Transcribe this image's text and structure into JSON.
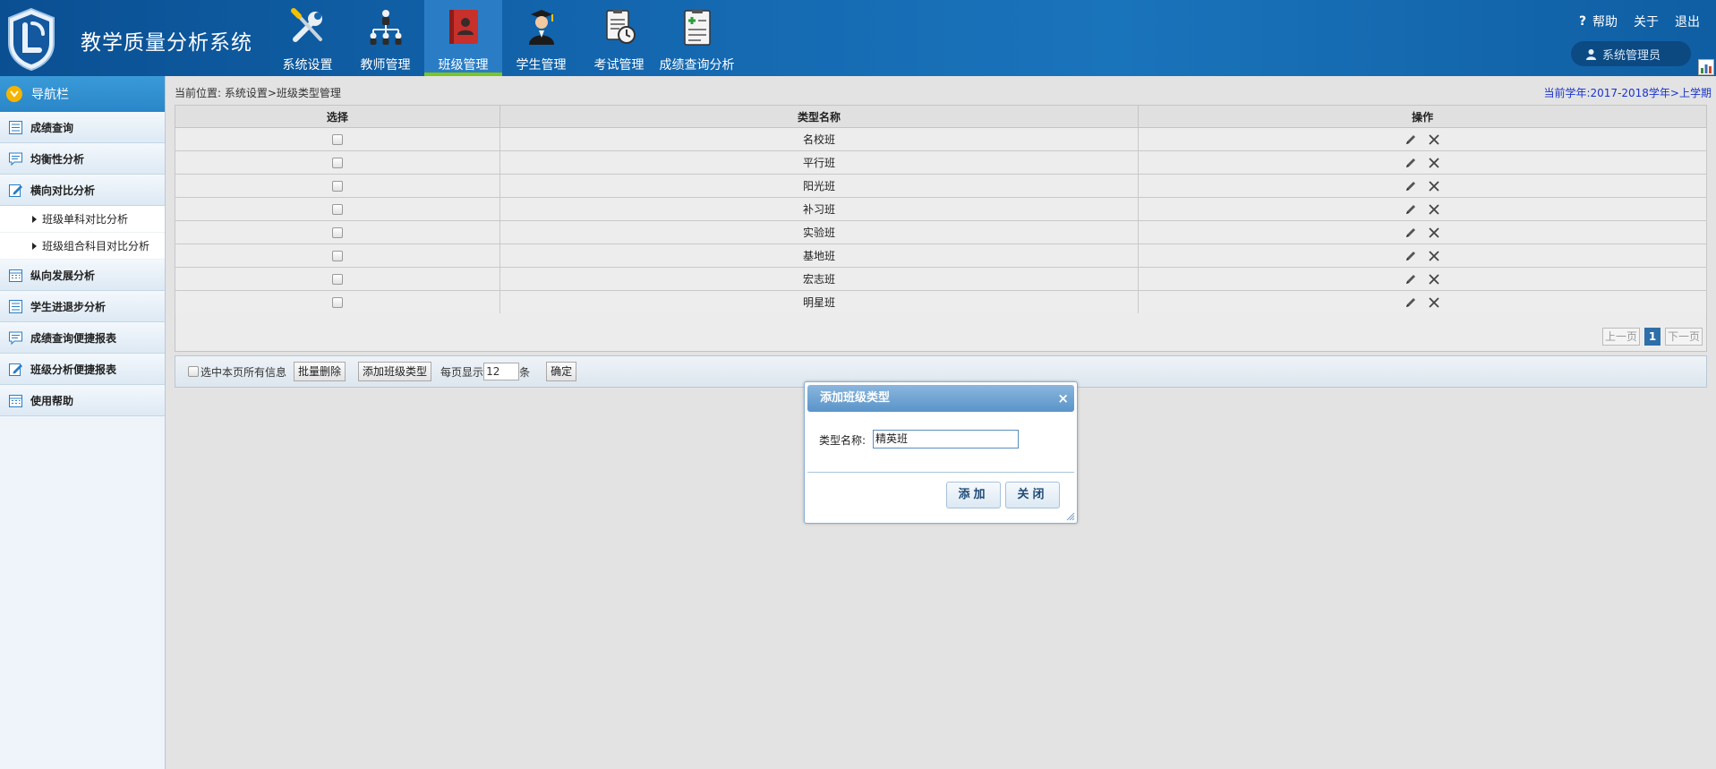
{
  "app": {
    "title": "教学质量分析系统"
  },
  "topnav": [
    {
      "label": "系统设置",
      "icon": "wrench-screwdriver-icon",
      "active": false
    },
    {
      "label": "教师管理",
      "icon": "org-chart-icon",
      "active": false
    },
    {
      "label": "班级管理",
      "icon": "class-book-icon",
      "active": true
    },
    {
      "label": "学生管理",
      "icon": "graduate-icon",
      "active": false
    },
    {
      "label": "考试管理",
      "icon": "exam-clock-icon",
      "active": false
    },
    {
      "label": "成绩查询分析",
      "icon": "clipboard-plus-icon",
      "active": false
    }
  ],
  "toplinks": {
    "help": "帮助",
    "about": "关于",
    "logout": "退出"
  },
  "user": {
    "name": "系统管理员"
  },
  "sidebar": {
    "title": "导航栏",
    "items": [
      {
        "label": "成绩查询"
      },
      {
        "label": "均衡性分析"
      },
      {
        "label": "横向对比分析"
      },
      {
        "label": "纵向发展分析"
      },
      {
        "label": "学生进退步分析"
      },
      {
        "label": "成绩查询便捷报表"
      },
      {
        "label": "班级分析便捷报表"
      },
      {
        "label": "使用帮助"
      }
    ],
    "subitems": [
      {
        "label": "班级单科对比分析"
      },
      {
        "label": "班级组合科目对比分析"
      }
    ]
  },
  "breadcrumb": "当前位置: 系统设置>班级类型管理",
  "current_year": "当前学年:2017-2018学年>上学期",
  "table": {
    "headers": {
      "select": "选择",
      "name": "类型名称",
      "ops": "操作"
    },
    "rows": [
      {
        "name": "名校班"
      },
      {
        "name": "平行班"
      },
      {
        "name": "阳光班"
      },
      {
        "name": "补习班"
      },
      {
        "name": "实验班"
      },
      {
        "name": "基地班"
      },
      {
        "name": "宏志班"
      },
      {
        "name": "明星班"
      }
    ]
  },
  "pager": {
    "prev": "上一页",
    "current": "1",
    "next": "下一页"
  },
  "toolbar": {
    "select_all": "选中本页所有信息",
    "batch_delete": "批量删除",
    "add_type": "添加班级类型",
    "per_page_label": "每页显示",
    "per_page_value": "12",
    "per_page_unit": "条",
    "confirm": "确定"
  },
  "dialog": {
    "title": "添加班级类型",
    "close": "×",
    "field_label": "类型名称:",
    "field_value": "精英班",
    "add": "添加",
    "close_btn": "关闭"
  },
  "colors": {
    "header_blue": "#1366ae",
    "active_tab": "#2a7dc5",
    "active_underline": "#7bc61f",
    "year_text": "#1a33cc"
  }
}
